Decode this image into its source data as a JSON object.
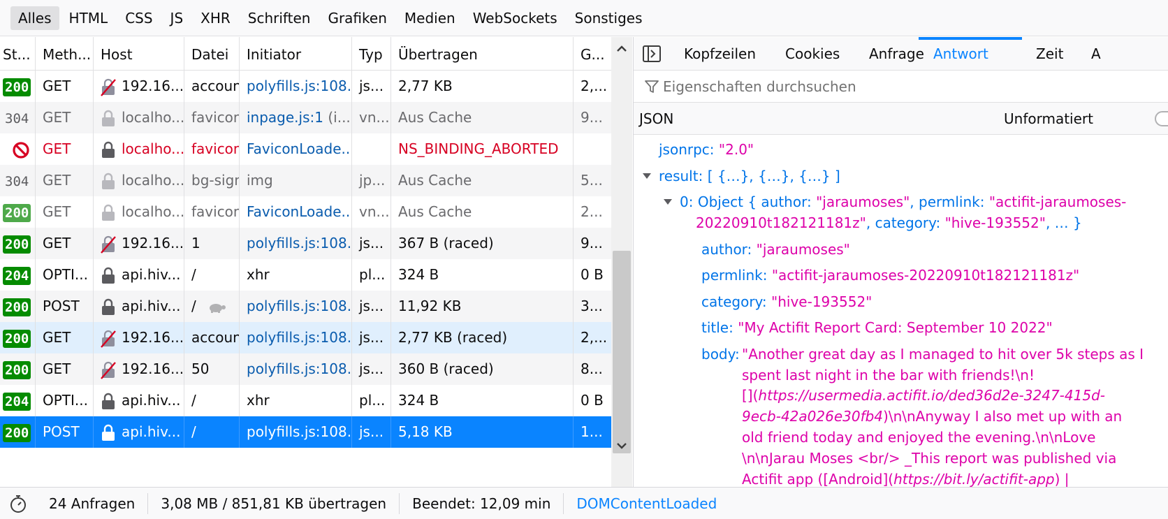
{
  "filter_tabs": [
    "Alles",
    "HTML",
    "CSS",
    "JS",
    "XHR",
    "Schriften",
    "Grafiken",
    "Medien",
    "WebSockets",
    "Sonstiges"
  ],
  "columns": {
    "status": "St...",
    "method": "Meth...",
    "host": "Host",
    "file": "Datei",
    "initiator": "Initiator",
    "type": "Typ",
    "transferred": "Übertragen",
    "size": "G..."
  },
  "rows": [
    {
      "status": "200",
      "status_style": "ok",
      "method": "GET",
      "host": "192.16...",
      "lock": "broken",
      "file": "account",
      "initiator": "polyfills.js",
      "initiator_loc": ":108...",
      "type": "js...",
      "transferred": "2,77 KB",
      "size": "2,...",
      "bg": "even"
    },
    {
      "status": "304",
      "status_style": "plain",
      "method": "GET",
      "host": "localho...",
      "lock": "grey",
      "file": "favicon.",
      "initiator": "inpage.js",
      "initiator_loc": ":1",
      "initiator_extra": " (i...",
      "type": "vn...",
      "transferred": "Aus Cache",
      "size": "9...",
      "bg": "odd",
      "muted": true
    },
    {
      "status": "",
      "status_style": "blocked",
      "method": "GET",
      "host": "localho...",
      "lock": "dark",
      "file": "favicon.",
      "initiator": "FaviconLoade...",
      "initiator_loc": "",
      "type": "",
      "transferred": "NS_BINDING_ABORTED",
      "size": "",
      "bg": "even",
      "error": true
    },
    {
      "status": "304",
      "status_style": "plain",
      "method": "GET",
      "host": "localho...",
      "lock": "grey",
      "file": "bg-sign",
      "initiator": "img",
      "initiator_loc": "",
      "type": "jp...",
      "transferred": "Aus Cache",
      "size": "5...",
      "bg": "odd",
      "muted": true,
      "initiator_plain": true
    },
    {
      "status": "200",
      "status_style": "light",
      "method": "GET",
      "host": "localho...",
      "lock": "grey",
      "file": "favicon.",
      "initiator": "FaviconLoade...",
      "initiator_loc": "",
      "type": "vn...",
      "transferred": "Aus Cache",
      "size": "2...",
      "bg": "even",
      "muted": true
    },
    {
      "status": "200",
      "status_style": "ok",
      "method": "GET",
      "host": "192.16...",
      "lock": "broken",
      "file": "1",
      "initiator": "polyfills.js",
      "initiator_loc": ":108...",
      "type": "js...",
      "transferred": "367 B (raced)",
      "size": "9...",
      "bg": "odd"
    },
    {
      "status": "204",
      "status_style": "ok",
      "method": "OPTI...",
      "host": "api.hiv...",
      "lock": "dark",
      "file": "/",
      "initiator": "xhr",
      "initiator_loc": "",
      "type": "pl...",
      "transferred": "324 B",
      "size": "0 B",
      "bg": "even",
      "initiator_plain": true
    },
    {
      "status": "200",
      "status_style": "ok",
      "method": "POST",
      "host": "api.hiv...",
      "lock": "dark",
      "file": "/",
      "turtle": true,
      "initiator": "polyfills.js",
      "initiator_loc": ":108...",
      "type": "js...",
      "transferred": "11,92 KB",
      "size": "3...",
      "bg": "odd"
    },
    {
      "status": "200",
      "status_style": "ok",
      "method": "GET",
      "host": "192.16...",
      "lock": "broken",
      "file": "account",
      "initiator": "polyfills.js",
      "initiator_loc": ":108...",
      "type": "js...",
      "transferred": "2,77 KB (raced)",
      "size": "2,...",
      "bg": "hover"
    },
    {
      "status": "200",
      "status_style": "ok",
      "method": "GET",
      "host": "192.16...",
      "lock": "broken",
      "file": "50",
      "initiator": "polyfills.js",
      "initiator_loc": ":108...",
      "type": "js...",
      "transferred": "360 B (raced)",
      "size": "8...",
      "bg": "odd"
    },
    {
      "status": "204",
      "status_style": "ok",
      "method": "OPTI...",
      "host": "api.hiv...",
      "lock": "dark",
      "file": "/",
      "initiator": "xhr",
      "initiator_loc": "",
      "type": "pl...",
      "transferred": "324 B",
      "size": "0 B",
      "bg": "even",
      "initiator_plain": true
    },
    {
      "status": "200",
      "status_style": "ok",
      "method": "POST",
      "host": "api.hiv...",
      "lock": "white",
      "file": "/",
      "initiator": "polyfills.js",
      "initiator_loc": ":108...",
      "type": "js...",
      "transferred": "5,18 KB",
      "size": "1...",
      "bg": "selected"
    }
  ],
  "details_tabs": [
    "Kopfzeilen",
    "Cookies",
    "Anfrage",
    "Antwort",
    "Zeit",
    "A"
  ],
  "details_active_tab": "Antwort",
  "search": {
    "placeholder": "Eigenschaften durchsuchen"
  },
  "json_header": {
    "label": "JSON",
    "raw_toggle": "Unformatiert"
  },
  "tree": {
    "jsonrpc_key": "jsonrpc:",
    "jsonrpc_val": "\"2.0\"",
    "result_key": "result:",
    "result_val": "[ {…}, {…}, {…} ]",
    "obj0_key": "0:",
    "obj0_summary_a": "Object { author: ",
    "obj0_summary_author": "\"jaraumoses\"",
    "obj0_summary_b": ", permlink: ",
    "obj0_summary_permlink_1": "\"actifit-jaraumoses-",
    "obj0_summary_permlink_2": "20220910t182121181z\"",
    "obj0_summary_c": ", category: ",
    "obj0_summary_category": "\"hive-193552\"",
    "obj0_summary_d": ", … }",
    "author_key": "author:",
    "author_val": "\"jaraumoses\"",
    "permlink_key": "permlink:",
    "permlink_val": "\"actifit-jaraumoses-20220910t182121181z\"",
    "category_key": "category:",
    "category_val": "\"hive-193552\"",
    "title_key": "title:",
    "title_val": "\"My Actifit Report Card: September 10 2022\"",
    "body_key": "body:",
    "body_1": "\"Another great day as I managed to hit over 5k steps as I",
    "body_2": "spent last night in the bar with friends!\\n!",
    "body_3a": "[](",
    "body_3b": "https://usermedia.actifit.io/ded36d2e-3247-415d-",
    "body_4a": "9ecb-42a026e30fb4",
    "body_4b": ")\\n\\nAnyway I also met up with an",
    "body_5": "old friend today and enjoyed the evening.\\n\\nLove",
    "body_6": "\\n\\nJarau Moses <br/> _This report was published via",
    "body_7a": "Actifit app ([Android](",
    "body_7b": "https://bit.ly/actifit-app",
    "body_7c": ") |"
  },
  "footer": {
    "requests": "24 Anfragen",
    "transferred": "3,08 MB / 851,81 KB übertragen",
    "finished": "Beendet: 12,09 min",
    "dcl": "DOMContentLoaded"
  },
  "colors": {
    "accent": "#0a84ff",
    "status_ok": "#058b00",
    "error": "#d70022",
    "json_key": "#0074e8",
    "json_string": "#dd00a9"
  }
}
